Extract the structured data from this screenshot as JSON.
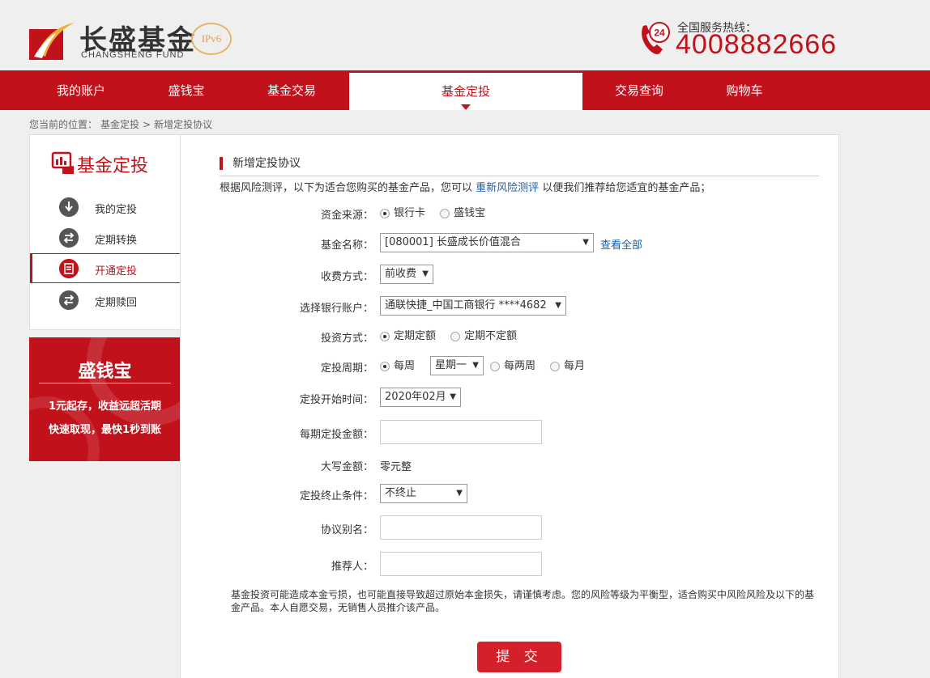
{
  "brand": {
    "name_cn": "长盛基金",
    "name_en": "CHANGSHENG FUND",
    "ipv6": "IPv6",
    "hotline_label": "全国服务热线：",
    "hotline_number": "4008882666",
    "hotline_badge": "24"
  },
  "nav": {
    "items": [
      {
        "label": "我的账户"
      },
      {
        "label": "盛钱宝"
      },
      {
        "label": "基金交易"
      },
      {
        "label": "基金定投"
      },
      {
        "label": "交易查询"
      },
      {
        "label": "购物车"
      }
    ],
    "active": "基金定投"
  },
  "breadcrumb": {
    "prefix": "您当前的位置：",
    "crumbs": [
      "基金定投",
      ">",
      "新增定投协议"
    ]
  },
  "sidebar": {
    "title": "基金定投",
    "items": [
      {
        "label": "我的定投"
      },
      {
        "label": "定期转换"
      },
      {
        "label": "开通定投"
      },
      {
        "label": "定期赎回"
      }
    ],
    "active": "开通定投"
  },
  "promo": {
    "title": "盛钱宝",
    "line1": "1元起存，收益远超活期",
    "line2": "快速取现，最快1秒到账"
  },
  "form": {
    "section_title": "新增定投协议",
    "intro_before": "根据风险测评，以下为适合您购买的基金产品，您可以",
    "intro_link": "重新风险测评",
    "intro_after": "以便我们推荐给您适宜的基金产品；",
    "source": {
      "label": "资金来源：",
      "options": [
        "银行卡",
        "盛钱宝"
      ],
      "selected": "银行卡"
    },
    "fund": {
      "label": "基金名称：",
      "value": "[080001] 长盛成长价值混合",
      "link": "查看全部"
    },
    "fee": {
      "label": "收费方式：",
      "value": "前收费"
    },
    "bank": {
      "label": "选择银行账户：",
      "value": "通联快捷_中国工商银行 ****4682"
    },
    "method": {
      "label": "投资方式：",
      "options": [
        "定期定额",
        "定期不定额"
      ],
      "selected": "定期定额"
    },
    "period": {
      "label": "定投周期：",
      "options": [
        "每周",
        "每两周",
        "每月"
      ],
      "selected": "每周",
      "weekday": "星期一"
    },
    "start": {
      "label": "定投开始时间：",
      "value": "2020年02月"
    },
    "amount": {
      "label": "每期定投金额：",
      "value": ""
    },
    "capital": {
      "label": "大写金额：",
      "value": "零元整"
    },
    "end": {
      "label": "定投终止条件：",
      "value": "不终止"
    },
    "alias": {
      "label": "协议别名：",
      "value": ""
    },
    "referrer": {
      "label": "推荐人：",
      "value": ""
    },
    "notice": "基金投资可能造成本金亏损，也可能直接导致超过原始本金损失，请谨慎考虑。您的风险等级为平衡型，适合购买中风险风险及以下的基金产品。本人自愿交易，无销售人员推介该产品。",
    "submit": "提 交"
  },
  "colors": {
    "brand_red": "#c1121c",
    "link_blue": "#1a5fa8",
    "button_red": "#d4202a"
  }
}
